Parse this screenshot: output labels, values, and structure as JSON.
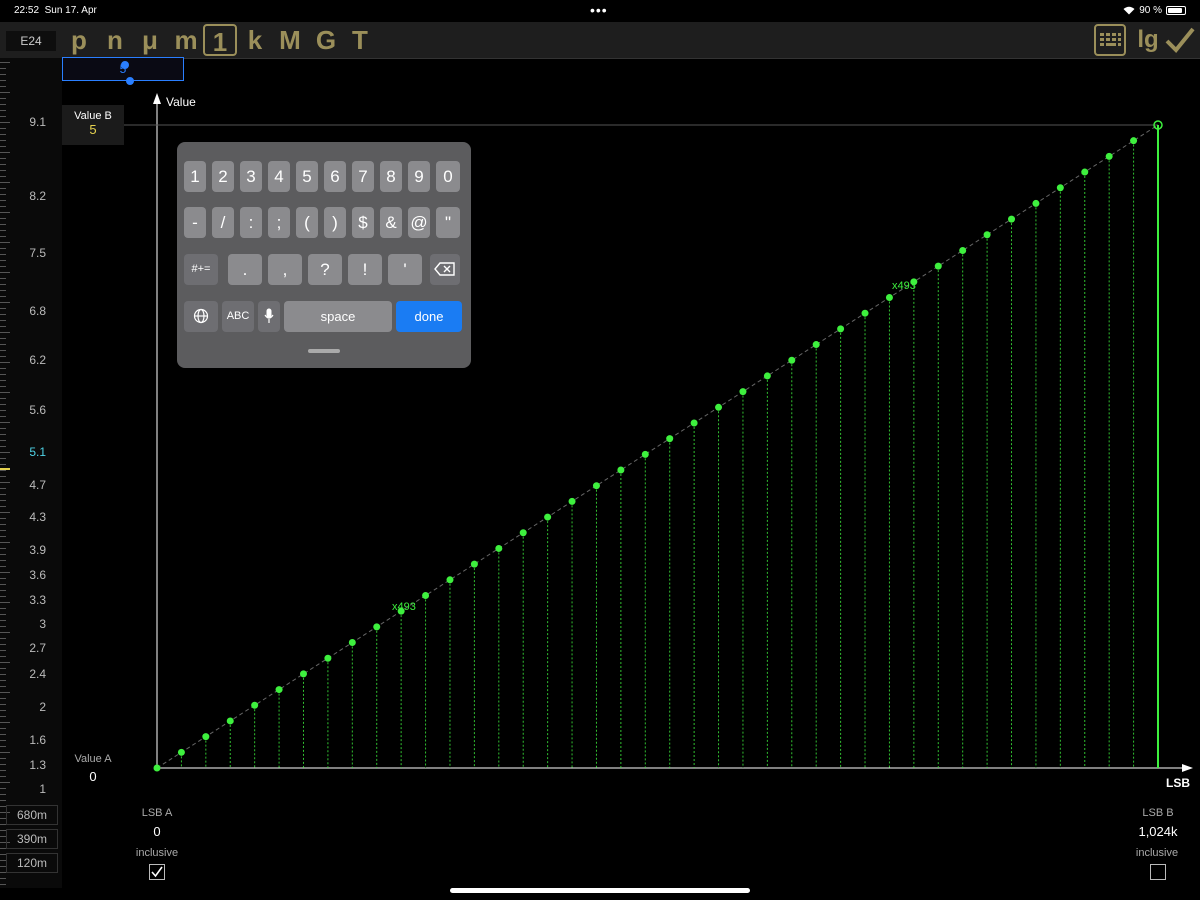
{
  "status": {
    "time": "22:52",
    "date": "Sun 17. Apr",
    "dots": "•••",
    "battery": "90 %"
  },
  "toolbar": {
    "series": "E24",
    "prefixes": [
      "p",
      "n",
      "μ",
      "m",
      "1",
      "k",
      "M",
      "G",
      "T"
    ],
    "selected_prefix": "1",
    "keyboard_button_icon": "keyboard-icon",
    "log_button_label": "lg",
    "confirm_icon": "checkmark-icon"
  },
  "value_input": {
    "value": "5"
  },
  "value_b": {
    "label": "Value B",
    "value": "5"
  },
  "scale": {
    "labels": [
      "9.1",
      "8.2",
      "7.5",
      "6.8",
      "6.2",
      "5.6",
      "5.1",
      "4.7",
      "4.3",
      "3.9",
      "3.6",
      "3.3",
      "3",
      "2.7",
      "2.4",
      "2",
      "1.6",
      "1.3",
      "1",
      "680m",
      "390m",
      "120m"
    ],
    "highlighted": "5.1"
  },
  "chart": {
    "y_axis_label": "Value",
    "x_axis_label": "LSB",
    "value_a_label": "Value A",
    "value_a": "0",
    "lsb_a_label": "LSB A",
    "lsb_a": "0",
    "lsb_b_label": "LSB B",
    "lsb_b": "1,024k",
    "inclusive_label": "inclusive",
    "inclusive_a_checked": true,
    "inclusive_b_checked": false,
    "annotation": "x493",
    "colors": {
      "series": "#3ef03e",
      "accent": "#9b8f5a",
      "highlight": "#4fd3e6",
      "input": "#2a7fff"
    }
  },
  "chart_data": {
    "type": "scatter",
    "x_start": 0,
    "x_end": 1024000,
    "y_start": 0,
    "y_end": 5,
    "x_labels": [
      "0",
      "1,024k"
    ],
    "y_labels": [
      "0",
      "5"
    ],
    "points_drawn": 41,
    "annotation": "x493"
  },
  "keyboard": {
    "row1": [
      "1",
      "2",
      "3",
      "4",
      "5",
      "6",
      "7",
      "8",
      "9",
      "0"
    ],
    "row2": [
      "-",
      "/",
      ":",
      ";",
      "(",
      ")",
      "$",
      "&",
      "@",
      "\""
    ],
    "row3_left": "#+=",
    "row3": [
      ".",
      ",",
      "?",
      "!",
      "'"
    ],
    "globe_icon": "globe-icon",
    "abc": "ABC",
    "mic_icon": "microphone-icon",
    "space": "space",
    "done": "done",
    "backspace_icon": "backspace-icon"
  }
}
